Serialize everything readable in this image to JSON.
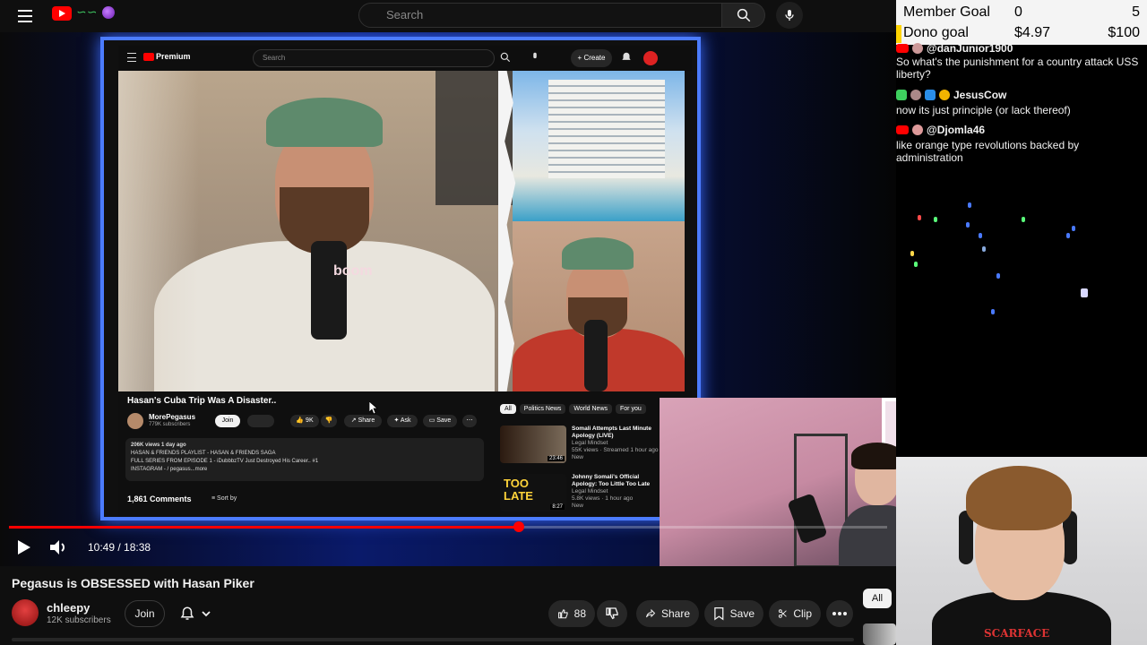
{
  "header": {
    "search_placeholder": "Search"
  },
  "player": {
    "time": "10:49 / 18:38",
    "progress_fraction": 0.5805,
    "embedded": {
      "search_placeholder": "Search",
      "logo_text": "Premium",
      "create_label": "Create",
      "video_title": "Hasan's Cuba Trip Was A Disaster..",
      "channel_name": "MorePegasus",
      "channel_subs": "779K subscribers",
      "join_label": "Join",
      "likes": "9K",
      "share_label": "Share",
      "ask_label": "Ask",
      "save_label": "Save",
      "desc_line1": "206K views  1 day ago",
      "desc_line2": "HASAN & FRIENDS PLAYLIST -  HASAN & FRIENDS SAGA",
      "desc_line3": "FULL SERIES FROM EPISODE 1 -  iDubbbzTV Just Destroyed His Career.. #1",
      "desc_line4": "INSTAGRAM - / pegasus...more",
      "comments_count": "1,861 Comments",
      "sort_label": "Sort by",
      "chips": [
        "All",
        "Politics News",
        "World News",
        "For you"
      ],
      "recs": [
        {
          "title": "Somali Attempts Last Minute Apology (LIVE)",
          "channel": "Legal Mindset",
          "meta": "55K views · Streamed 1 hour ago",
          "badge": "New",
          "duration": "23:46"
        },
        {
          "title": "Johnny Somali's Official Apology: Too Little Too Late",
          "channel": "Legal Mindset",
          "meta": "5.8K views · 1 hour ago",
          "badge": "New",
          "duration": "8:27"
        }
      ],
      "overlay_text": "boom",
      "thumb_text": "TOO LATE"
    }
  },
  "video": {
    "title": "Pegasus is OBSESSED with Hasan Piker",
    "channel_name": "chleepy",
    "channel_subs": "12K subscribers",
    "join_label": "Join",
    "likes": "88",
    "share_label": "Share",
    "save_label": "Save",
    "clip_label": "Clip"
  },
  "sidebar": {
    "chip_all": "All"
  },
  "stream_panel": {
    "member_goal_label": "Member Goal",
    "member_goal_current": "0",
    "member_goal_max": "5",
    "dono_goal_label": "Dono goal",
    "dono_goal_current": "$4.97",
    "dono_goal_max": "$100",
    "chat": [
      {
        "user": "@danJunior1900",
        "text": "So what's the punishment for a country attack USS liberty?"
      },
      {
        "user": "JesusCow",
        "text": "now its just principle (or lack thereof)"
      },
      {
        "user": "@Djomla46",
        "text": "like orange type revolutions backed by administration"
      }
    ],
    "facecam_shirt_text": "SCARFACE"
  },
  "colors": {
    "accent_red": "#ff0000",
    "frame_blue": "#4c7cff",
    "goal_bar": "#ffd400"
  }
}
